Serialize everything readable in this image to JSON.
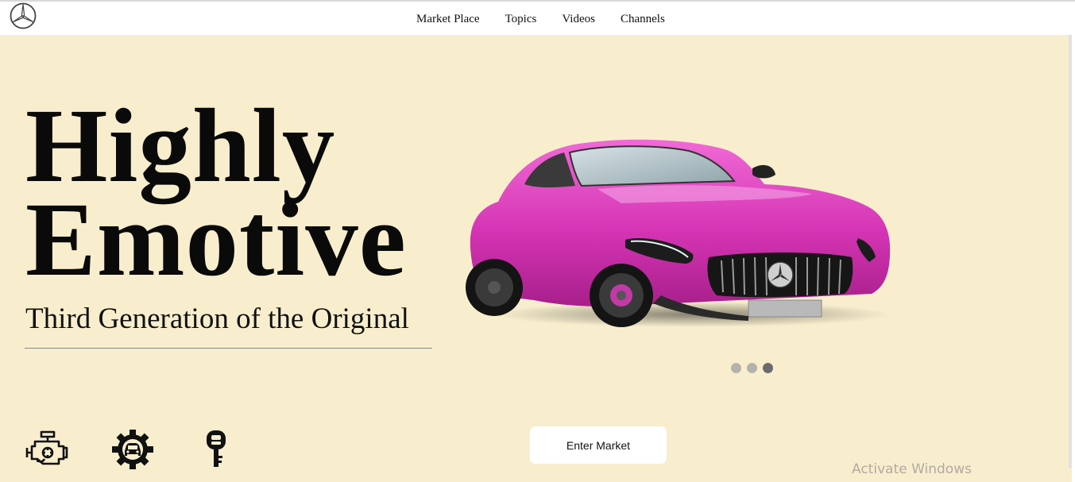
{
  "brand": {
    "logo_icon": "mercedes-star-icon"
  },
  "nav": {
    "items": [
      {
        "label": "Market Place"
      },
      {
        "label": "Topics"
      },
      {
        "label": "Videos"
      },
      {
        "label": "Channels"
      }
    ]
  },
  "hero": {
    "headline_line1": "Highly",
    "headline_line2": "Emotive",
    "subheadline": "Third Generation of the Original",
    "car_image": "pink-sports-coupe",
    "car_color": "#d534b4",
    "background_color": "#f8eece",
    "carousel": {
      "total": 3,
      "active_index": 2
    },
    "features": [
      {
        "icon": "engine-icon"
      },
      {
        "icon": "gear-car-icon"
      },
      {
        "icon": "car-key-icon"
      }
    ],
    "cta_label": "Enter Market"
  },
  "overlay": {
    "watermark": "Activate Windows"
  }
}
